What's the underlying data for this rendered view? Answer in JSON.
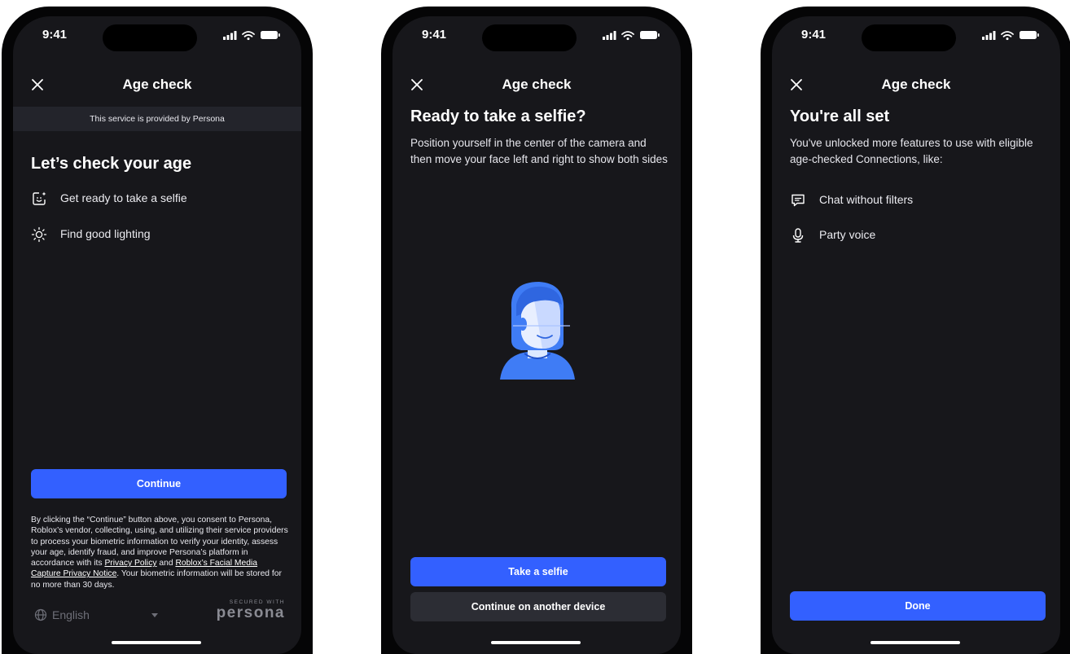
{
  "status_bar": {
    "time": "9:41"
  },
  "colors": {
    "accent": "#3360ff",
    "background": "#17171b",
    "secondary_button": "#2c2d34",
    "illustration": "#3f7cf5"
  },
  "screens": [
    {
      "title": "Age check",
      "provider_banner": "This service is provided by Persona",
      "heading": "Let’s check your age",
      "items": [
        {
          "icon": "selfie-sparkle-icon",
          "label": "Get ready to take a selfie"
        },
        {
          "icon": "sun-icon",
          "label": "Find good lighting"
        }
      ],
      "continue_label": "Continue",
      "consent": {
        "part1": "By clicking the “Continue” button above, you consent to Persona, Roblox’s vendor, collecting, using, and utilizing their service providers to process your biometric information to verify your identity, assess your age, identify fraud, and improve Persona’s platform in accordance with its ",
        "privacy_link": "Privacy Policy",
        "part2": " and ",
        "notice_link": "Roblox’s Facial Media Capture Privacy Notice",
        "part3": ". Your biometric information will be stored for no more than 30 days."
      },
      "language": "English",
      "secured_with": "SECURED WITH",
      "brand": "persona"
    },
    {
      "title": "Age check",
      "heading": "Ready to take a selfie?",
      "description": "Position yourself in the center of the camera and then move your face left and right to show both sides",
      "primary_label": "Take a selfie",
      "secondary_label": "Continue on another device"
    },
    {
      "title": "Age check",
      "heading": "You're all set",
      "description": "You've unlocked more features to use with eligible age-checked Connections, like:",
      "items": [
        {
          "icon": "chat-icon",
          "label": "Chat without filters"
        },
        {
          "icon": "microphone-icon",
          "label": "Party voice"
        }
      ],
      "done_label": "Done"
    }
  ]
}
